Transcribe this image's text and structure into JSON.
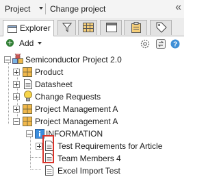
{
  "topbar": {
    "project_label": "Project",
    "change_project": "Change project",
    "collapse_icon": "double-chevron-left"
  },
  "tabs": [
    {
      "label": "Explorer",
      "icon": "explorer-icon"
    },
    {
      "label": "",
      "icon": "filter-icon"
    },
    {
      "label": "",
      "icon": "table-icon"
    },
    {
      "label": "",
      "icon": "window-icon"
    },
    {
      "label": "",
      "icon": "clipboard-icon"
    },
    {
      "label": "",
      "icon": "tag-icon"
    }
  ],
  "toolbar": {
    "add_label": "Add",
    "icons": [
      "settings-icon",
      "sync-icon",
      "help-icon"
    ]
  },
  "tree": [
    {
      "label": "Semiconductor Project 2.0",
      "icon": "project-icon",
      "expander": "minus"
    },
    {
      "label": "Product",
      "icon": "module-icon",
      "expander": "plus"
    },
    {
      "label": "Datasheet",
      "icon": "document-icon",
      "expander": "plus"
    },
    {
      "label": "Change Requests",
      "icon": "lightbulb-icon",
      "expander": "plus"
    },
    {
      "label": "Project Management A",
      "icon": "module-icon",
      "expander": "plus"
    },
    {
      "label": "Project Management A",
      "icon": "module-icon",
      "expander": "minus"
    },
    {
      "label": "INFORMATION",
      "icon": "info-icon",
      "expander": "minus"
    },
    {
      "label": "Test Requirements for Article",
      "icon": "document-icon",
      "expander": "plus"
    },
    {
      "label": "Team Members 4",
      "icon": "document-icon",
      "expander": "none"
    },
    {
      "label": "Excel Import Test",
      "icon": "document-icon",
      "expander": "none"
    }
  ],
  "colors": {
    "highlight": "#d9342b",
    "module": "#f1b84b",
    "add": "#2e7d32",
    "help": "#3f8fd6",
    "info": "#3c8ede"
  }
}
